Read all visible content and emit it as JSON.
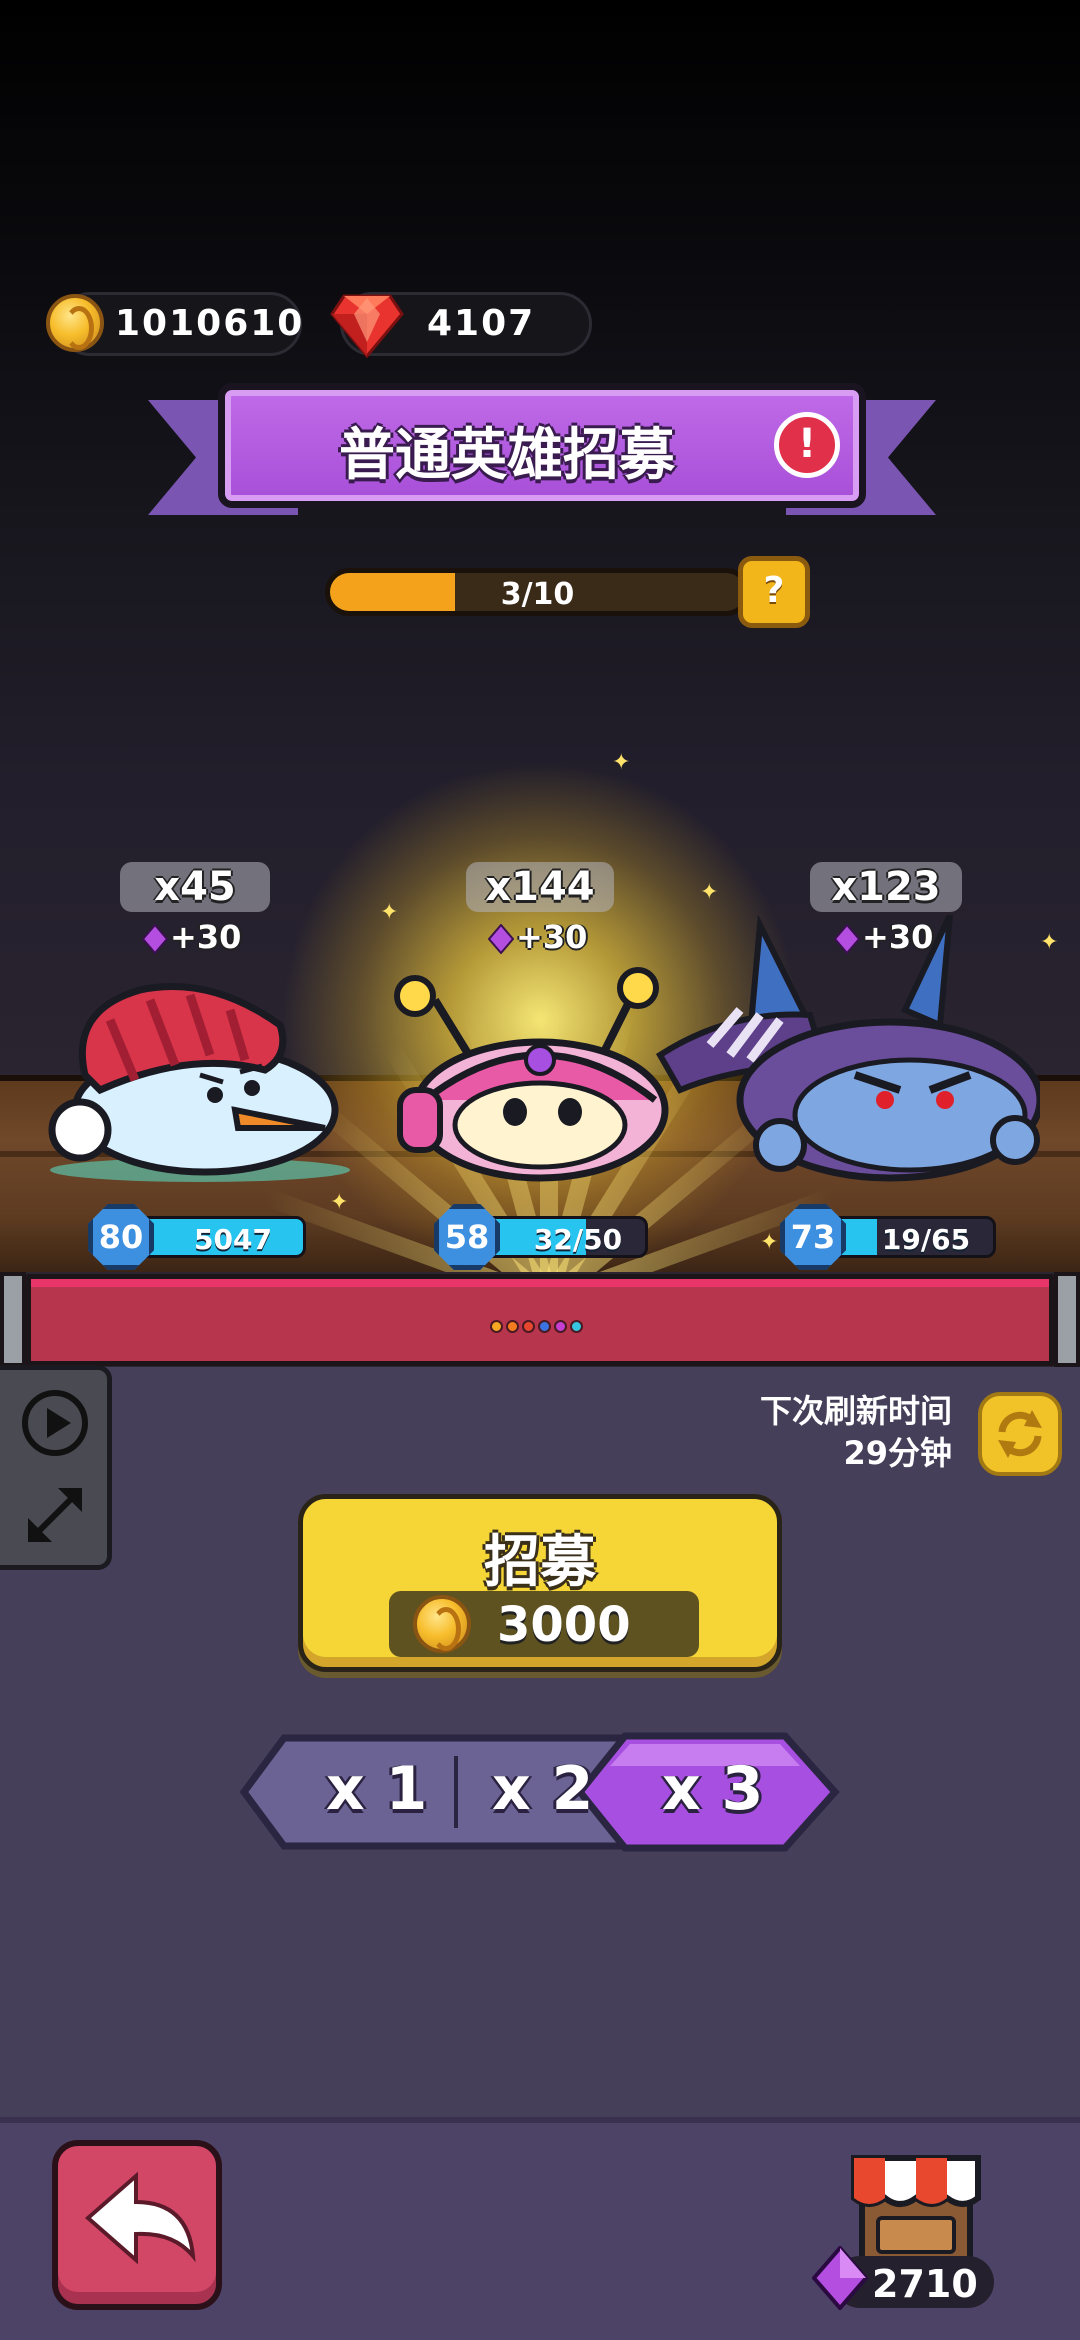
{
  "currencies": {
    "gold": "1010610",
    "rubies": "4107"
  },
  "title": {
    "text": "普通英雄招募",
    "alert_symbol": "!"
  },
  "progress": {
    "text": "3/10",
    "current": 3,
    "total": 10,
    "help_symbol": "?"
  },
  "heroes": [
    {
      "count": "x45",
      "bonus": "+30",
      "level": "80",
      "cards": "5047",
      "card_fraction": 1.0,
      "name": "snowman-hero"
    },
    {
      "count": "x144",
      "bonus": "+30",
      "level": "58",
      "cards": "32/50",
      "card_fraction": 0.64,
      "name": "pink-robot-hero"
    },
    {
      "count": "x123",
      "bonus": "+30",
      "level": "73",
      "cards": "19/65",
      "card_fraction": 0.29,
      "name": "blue-shadow-hero"
    }
  ],
  "page_dots": [
    "#f5a623",
    "#f57c1f",
    "#e8472f",
    "#3b73e0",
    "#c53fd1",
    "#36c5e0"
  ],
  "refresh": {
    "line1": "下次刷新时间",
    "line2": "29分钟"
  },
  "recruit": {
    "label": "招募",
    "price": "3000"
  },
  "multipliers": {
    "options": [
      "x 1",
      "x 2",
      "x 3"
    ],
    "selected": "x 3"
  },
  "shop": {
    "gems": "2710"
  },
  "colors": {
    "title_purple": "#b45be0",
    "recruit_yellow": "#f5d636",
    "selected_tab": "#a64fe0",
    "back_red": "#d24666"
  }
}
